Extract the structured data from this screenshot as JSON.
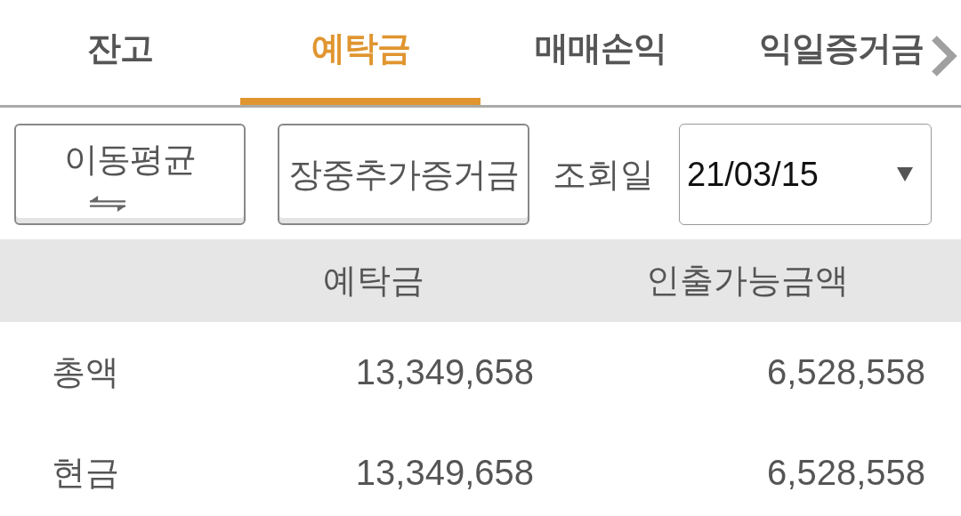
{
  "tabs": [
    {
      "label": "잔고",
      "selected": false
    },
    {
      "label": "예탁금",
      "selected": true
    },
    {
      "label": "매매손익",
      "selected": false
    },
    {
      "label": "익일증거금",
      "selected": false
    }
  ],
  "buttons": [
    {
      "label": "이동평균",
      "kind": "toggle"
    },
    {
      "label": "장중추가증거금",
      "kind": "plain"
    }
  ],
  "date_filter": {
    "label": "조회일",
    "value": "21/03/15"
  },
  "table": {
    "columns": [
      "예탁금",
      "인출가능금액"
    ],
    "rows": [
      {
        "label": "총액",
        "cells": [
          "13,349,658",
          "6,528,558"
        ]
      },
      {
        "label": "현금",
        "cells": [
          "13,349,658",
          "6,528,558"
        ]
      }
    ]
  }
}
